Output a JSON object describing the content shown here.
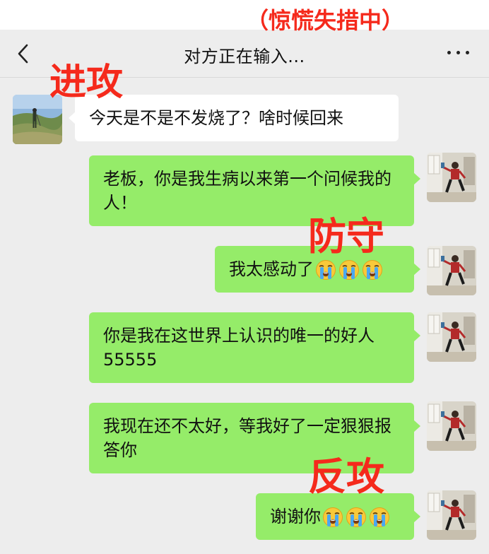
{
  "header": {
    "title": "对方正在输入...",
    "back_icon": "chevron-left-icon",
    "more_icon": "more-dots-icon"
  },
  "annotations": {
    "panic": "（惊慌失措中）",
    "attack": "进攻",
    "defend": "防守",
    "counter": "反攻"
  },
  "messages": [
    {
      "side": "left",
      "text": "今天是不是不发烧了？啥时候回来"
    },
    {
      "side": "right",
      "text": "老板，你是我生病以来第一个问候我的人！"
    },
    {
      "side": "right",
      "text": "我太感动了",
      "emoji": "crying-face-icon",
      "emoji_count": 3
    },
    {
      "side": "right",
      "text": "你是我在这世界上认识的唯一的好人 55555"
    },
    {
      "side": "right",
      "text": "我现在还不太好，等我好了一定狠狠报答你"
    },
    {
      "side": "right",
      "text": "谢谢你",
      "emoji": "crying-face-icon",
      "emoji_count": 3
    }
  ],
  "colors": {
    "background": "#ededed",
    "bubble_self": "#95ec69",
    "bubble_other": "#ffffff",
    "annotation_red": "#f52a1c"
  }
}
